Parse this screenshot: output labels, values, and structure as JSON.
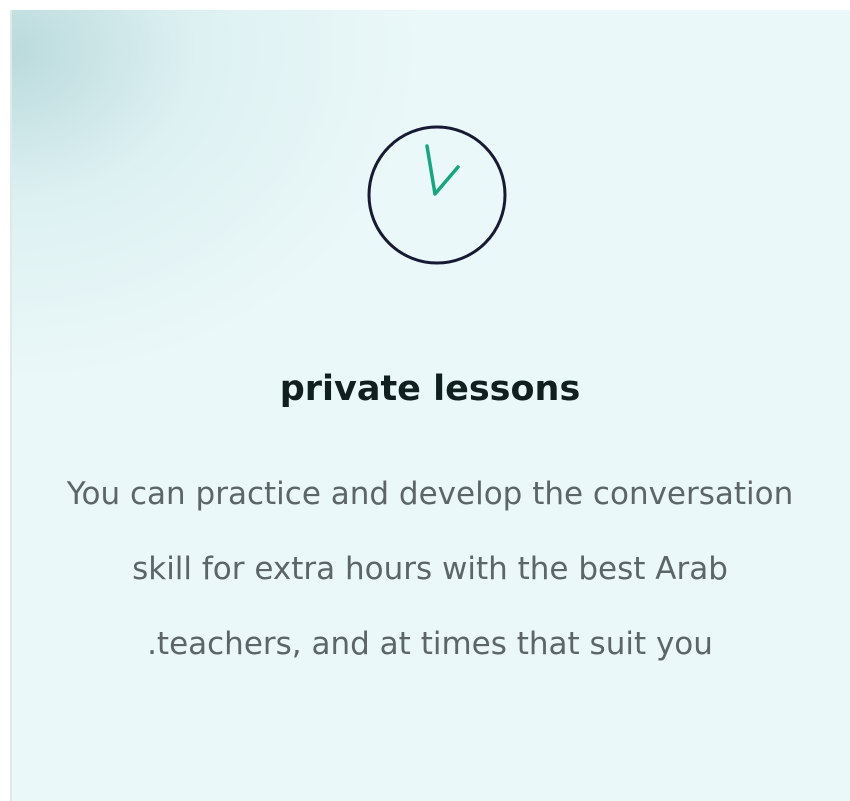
{
  "card": {
    "icon": "clock-icon",
    "title": "private lessons",
    "description_lines": [
      "You can practice and develop the conversation",
      "skill for extra hours with the best Arab",
      ".teachers, and at times that suit you"
    ]
  },
  "colors": {
    "card_background": "#ebf8f9",
    "clock_outline": "#161a33",
    "clock_hands": "#17a67f",
    "title": "#10201e",
    "description": "#5c6668"
  }
}
